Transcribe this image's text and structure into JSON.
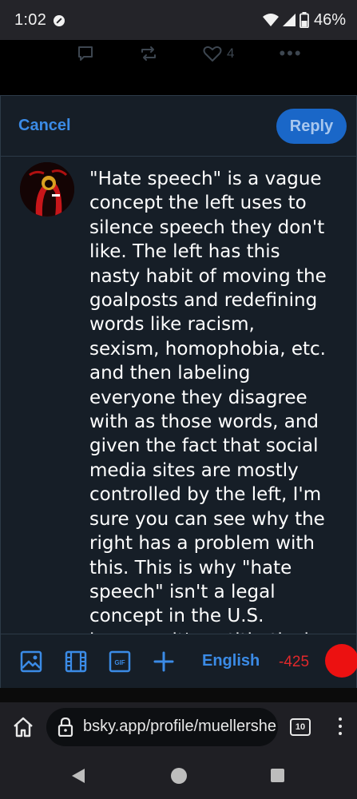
{
  "status_bar": {
    "time": "1:02",
    "battery_percent": "46%",
    "icons": [
      "dnd-icon",
      "wifi-icon",
      "signal-icon",
      "battery-icon"
    ]
  },
  "feed": {
    "like_count": "4",
    "icons": [
      "reply-icon",
      "repost-icon",
      "like-icon",
      "more-icon"
    ]
  },
  "composer": {
    "cancel_label": "Cancel",
    "reply_label": "Reply",
    "text": "\"Hate speech\" is a vague concept the left uses to silence speech they don't like. The left has this nasty habit of moving the goalposts and redefining words like racism, sexism, homophobia, etc. and then labeling everyone they disagree with as those words, and given the fact that social media sites are mostly controlled by the left, I'm sure you can see why the right has a problem with this. This is why \"hate speech\" isn't a legal concept in the U.S. because it's antithetical to free speech. Some argue"
  },
  "toolbar": {
    "language_label": "English",
    "char_count": "-425",
    "icons": [
      "image-icon",
      "video-icon",
      "gif-icon",
      "plus-icon"
    ],
    "accent_color": "#3b8be6",
    "over_limit_color": "#e0282b"
  },
  "browser": {
    "url": "bsky.app/profile/muellershe",
    "tab_count": "10"
  }
}
